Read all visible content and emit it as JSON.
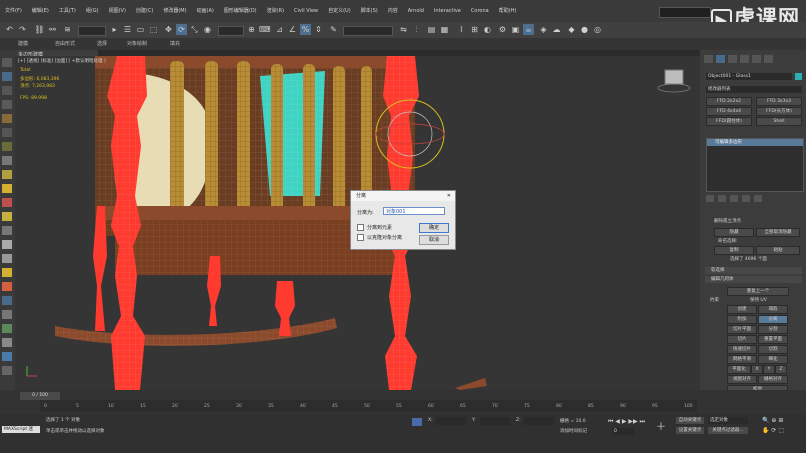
{
  "menu": [
    "文件(F)",
    "编辑(E)",
    "工具(T)",
    "组(G)",
    "视图(V)",
    "创建(C)",
    "修改器(M)",
    "动画(A)",
    "图形编辑器(D)",
    "渲染(R)",
    "Civil View",
    "自定义(U)",
    "脚本(S)",
    "内容",
    "Arnold",
    "Interactive",
    "Corona",
    "帮助(H)"
  ],
  "watermark": "虎课网",
  "ribbon_tabs": [
    "建模",
    "自由形式",
    "选择",
    "对象绘制",
    "填充"
  ],
  "panel_title": "多边形建模",
  "viewport": {
    "label": "[+] [透视] [标准] [边面] [ +默认明暗处理 ]",
    "stats_title": "Total",
    "polys": "多边形: 6,083,396",
    "verts": "顶点: 7,263,983",
    "fps": "FPS: 89.998"
  },
  "dialog": {
    "title": "分离",
    "label": "分离为:",
    "name_value": "对象001",
    "opt_element": "分离到元素",
    "opt_clone": "以克隆对象分离",
    "ok": "确定",
    "cancel": "取消"
  },
  "cmd": {
    "object_name": "Object001 - Glass1",
    "modifier_list": "修改器列表",
    "btn_a": "FFD 2x2x2",
    "btn_b": "FFD 3x3x3",
    "btn_c": "FFD 4x4x4",
    "btn_d": "FFD(长方体)",
    "btn_e": "FFD(圆柱体)",
    "btn_f": "Shell",
    "stack_item": "可编辑多边形",
    "sel_1": "删除孤立顶点",
    "sel_2": "隐藏",
    "sel_3": "全部取消隐藏",
    "sel_4": "命名选择:",
    "sel_5": "复制",
    "sel_6": "粘贴",
    "sel_count": "选择了 4696 个面",
    "rollout_soft": "软选择",
    "rollout_edit": "编辑几何体",
    "g1": "重复上一个",
    "g2": "约束",
    "g3": "保持 UV",
    "g4": "创建",
    "g5": "塌陷",
    "g6": "附加",
    "g7": "分离",
    "g8": "切片平面",
    "g9": "分割",
    "g10": "切片",
    "g11": "重置平面",
    "g12": "快速切片",
    "g13": "切割",
    "g14": "网格平滑",
    "g15": "细化",
    "g16": "平面化",
    "g17": "X",
    "g18": "Y",
    "g19": "Z",
    "g20": "视图对齐",
    "g21": "栅格对齐",
    "g22": "松弛",
    "g23": "隐藏选定对象",
    "g24": "全部取消隐藏"
  },
  "timeline": {
    "frame": "0 / 100",
    "ticks": [
      "0",
      "5",
      "10",
      "15",
      "20",
      "25",
      "30",
      "35",
      "40",
      "45",
      "50",
      "55",
      "60",
      "65",
      "70",
      "75",
      "80",
      "85",
      "90",
      "95",
      "100"
    ]
  },
  "status": {
    "maxscript": "MAXScript 迷",
    "selected": "选择了 1 个 对象",
    "hint": "单击或单击并拖动以选择对象",
    "grid": "栅格 = 10.0",
    "autokey": "自动关键点",
    "selected_obj": "选定对象",
    "setkey": "设置关键点",
    "keyfilter": "关键点过滤器...",
    "addtime": "添加时间标记",
    "x": "X:",
    "y": "Y:",
    "z": "Z:",
    "frame_num": "0"
  },
  "colors": {
    "selection_red": "#ff3b30",
    "wood": "#8b4a2b",
    "rail_yellow": "#b98d35"
  }
}
